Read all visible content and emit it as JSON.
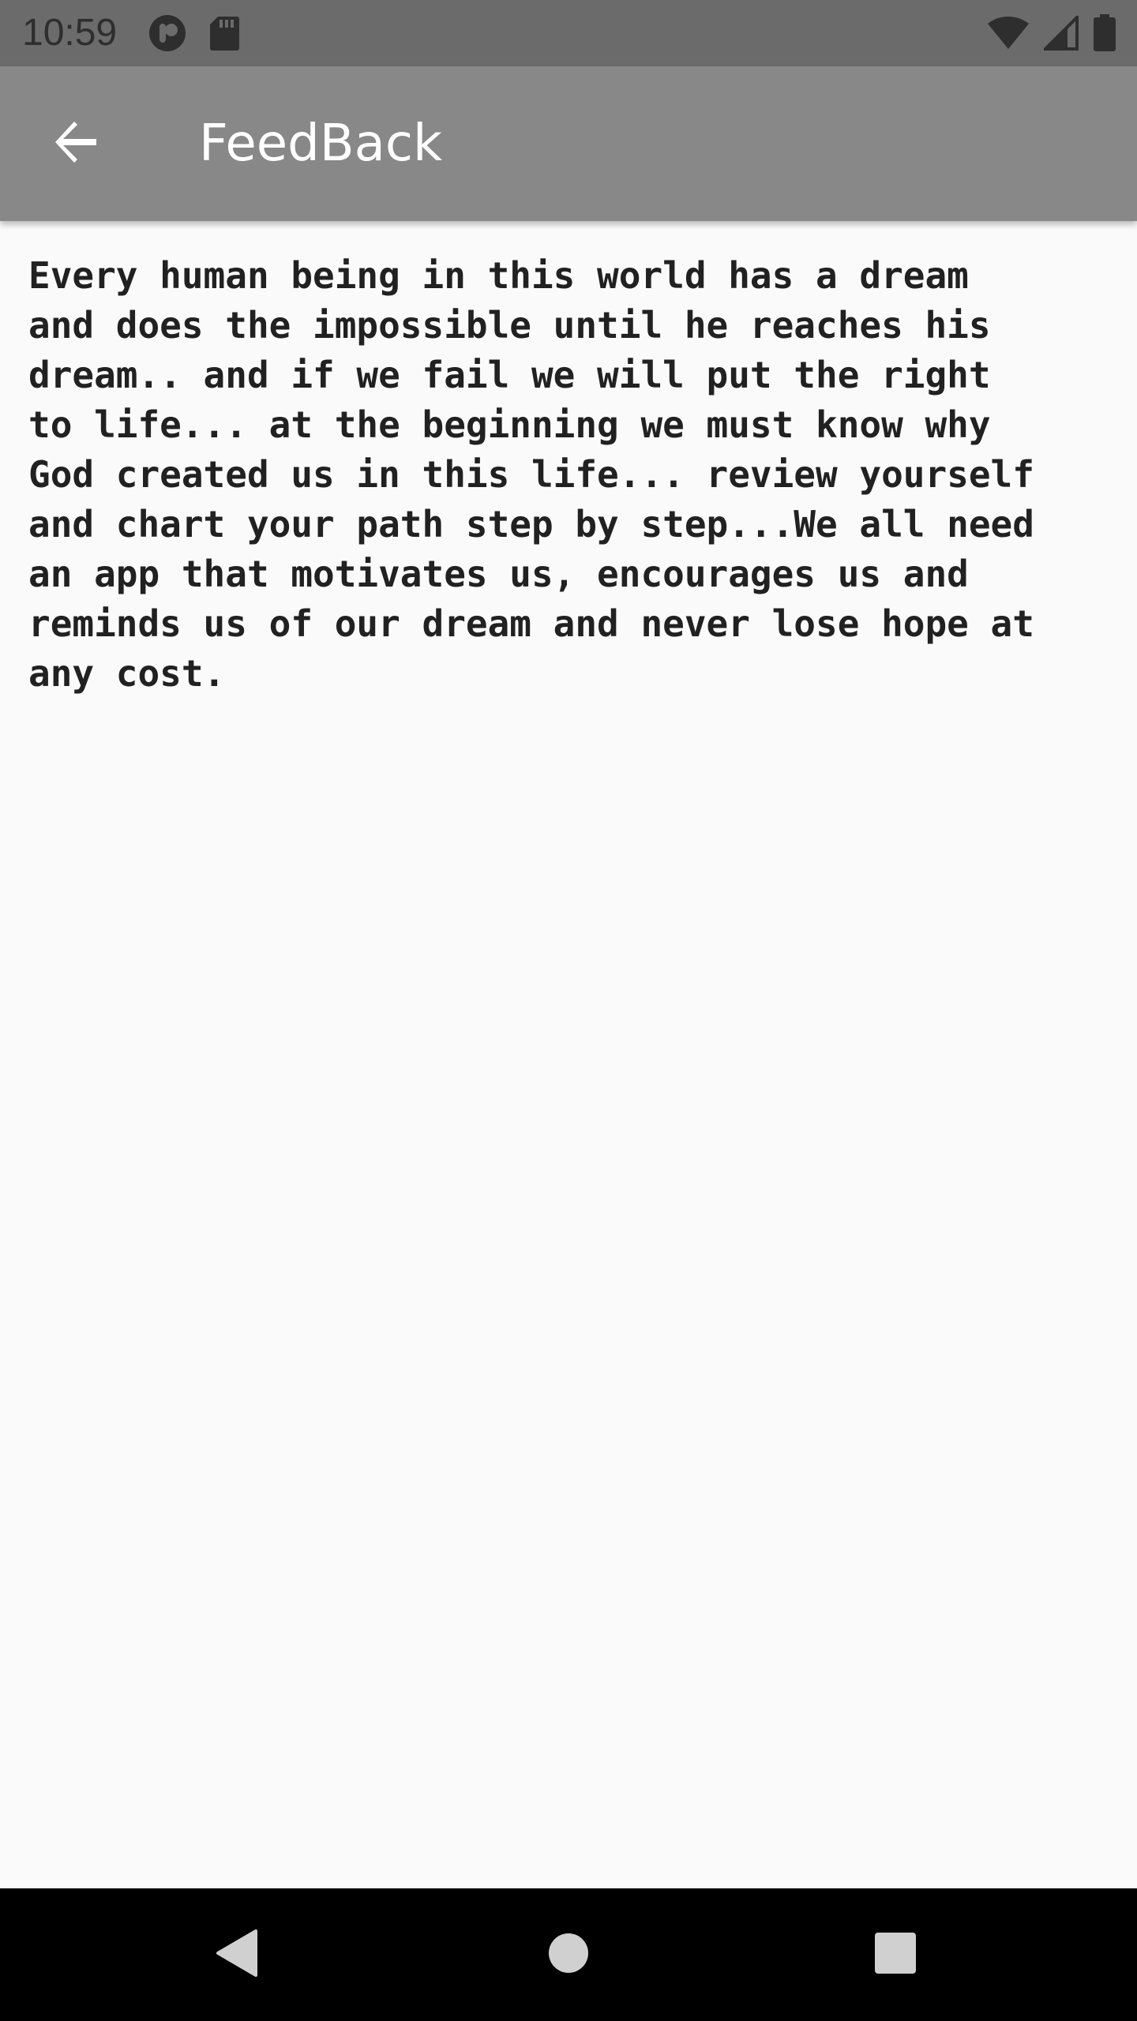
{
  "status_bar": {
    "time": "10:59",
    "left_icons": [
      "app-notification-icon",
      "sd-card-icon"
    ],
    "right_icons": [
      "wifi-icon",
      "cell-signal-icon",
      "battery-icon"
    ]
  },
  "app_bar": {
    "title": "FeedBack",
    "back_icon": "arrow-back-icon"
  },
  "content": {
    "feedback_lines": [
      "Every human being in this world has a dream",
      "and does the impossible until he reaches his",
      "dream.. and if we fail we will put the right",
      "to life... at the beginning we must know why",
      "God created us in this life... review yourself",
      "and chart your path step by step...We all need",
      "an app that motivates us, encourages us and",
      "reminds us of our dream and never lose hope at",
      "any cost."
    ]
  },
  "nav_bar": {
    "buttons": [
      "nav-back-icon",
      "nav-home-icon",
      "nav-recents-icon"
    ]
  },
  "colors": {
    "status_bar_bg": "#6b6b6b",
    "app_bar_bg": "#888888",
    "page_bg": "#fafafa",
    "text": "#212121",
    "nav_bar_bg": "#000000"
  }
}
